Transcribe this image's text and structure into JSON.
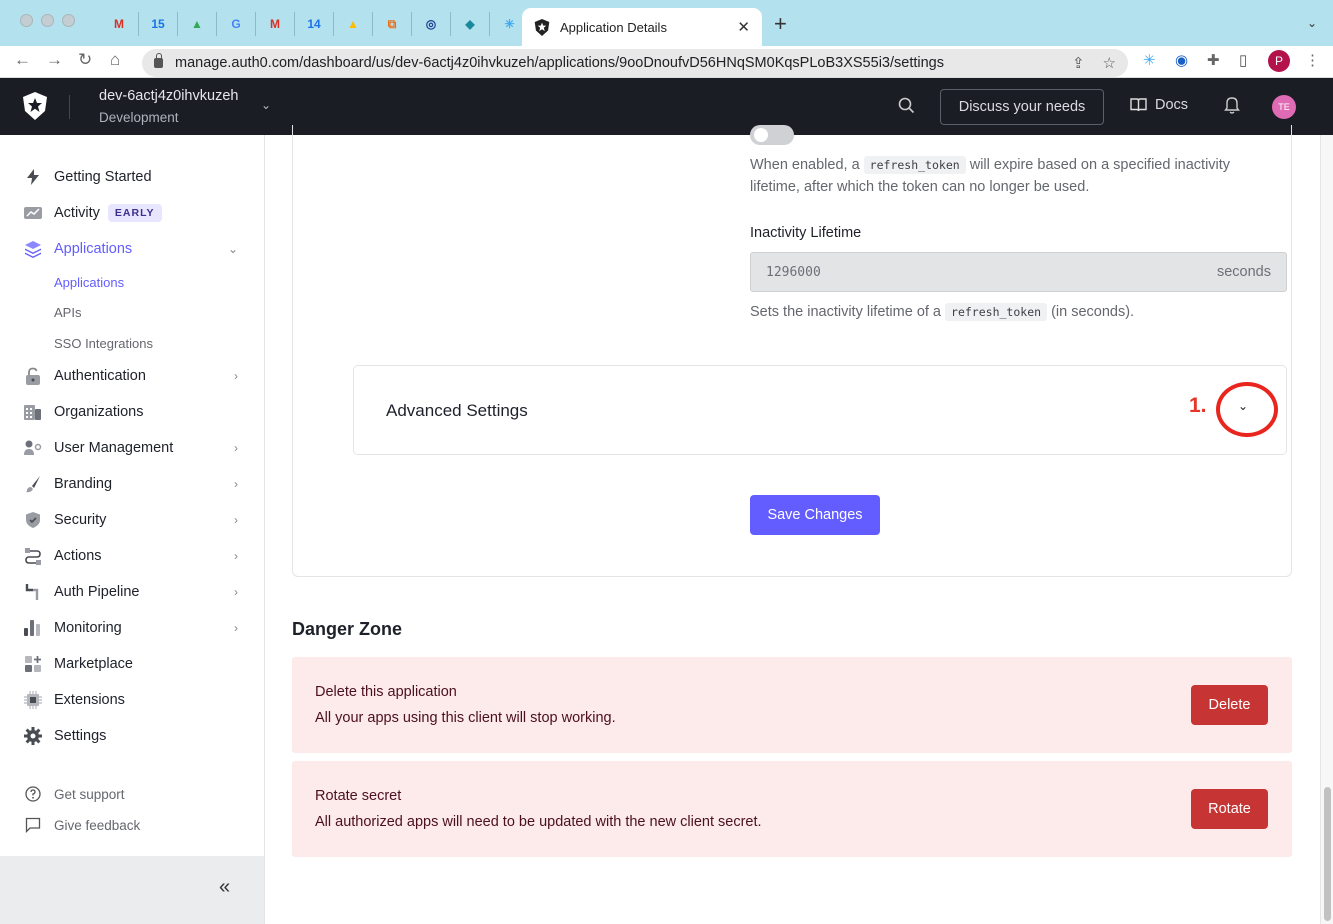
{
  "browser": {
    "pinned_tabs": [
      {
        "icon": "gmail-icon",
        "glyph": "M",
        "color": "#d93025"
      },
      {
        "icon": "calendar-icon",
        "glyph": "15",
        "color": "#1a73e8"
      },
      {
        "icon": "drive-icon",
        "glyph": "▲",
        "color": "#34a853"
      },
      {
        "icon": "google-icon",
        "glyph": "G",
        "color": "#4285f4"
      },
      {
        "icon": "gmail-icon",
        "glyph": "M",
        "color": "#d93025"
      },
      {
        "icon": "calendar-icon",
        "glyph": "14",
        "color": "#1a73e8"
      },
      {
        "icon": "drive-icon",
        "glyph": "▲",
        "color": "#fbbc04"
      },
      {
        "icon": "app-icon",
        "glyph": "⧉",
        "color": "#e8711a"
      },
      {
        "icon": "circle-app-icon",
        "glyph": "◎",
        "color": "#1c3f94"
      },
      {
        "icon": "diamond-icon",
        "glyph": "◆",
        "color": "#1a8a9a"
      },
      {
        "icon": "asterisk-icon",
        "glyph": "✳",
        "color": "#3fa9f5"
      }
    ],
    "active_tab_title": "Application Details",
    "url": "manage.auth0.com/dashboard/us/dev-6actj4z0ihvkuzeh/applications/9ooDnoufvD56HNqSM0KqsPLoB3XS55i3/settings",
    "profile_initial": "P"
  },
  "header": {
    "tenant_name": "dev-6actj4z0ihvkuzeh",
    "tenant_env": "Development",
    "discuss_label": "Discuss your needs",
    "docs_label": "Docs",
    "avatar_initials": "TE"
  },
  "sidebar": {
    "items": [
      {
        "label": "Getting Started",
        "icon": "lightning-icon"
      },
      {
        "label": "Activity",
        "icon": "activity-icon",
        "badge": "EARLY"
      },
      {
        "label": "Applications",
        "icon": "layers-icon"
      },
      {
        "label": "Authentication",
        "icon": "lock-icon"
      },
      {
        "label": "Organizations",
        "icon": "building-icon"
      },
      {
        "label": "User Management",
        "icon": "users-icon"
      },
      {
        "label": "Branding",
        "icon": "brush-icon"
      },
      {
        "label": "Security",
        "icon": "shield-icon"
      },
      {
        "label": "Actions",
        "icon": "actions-icon"
      },
      {
        "label": "Auth Pipeline",
        "icon": "pipeline-icon"
      },
      {
        "label": "Monitoring",
        "icon": "bar-chart-icon"
      },
      {
        "label": "Marketplace",
        "icon": "marketplace-icon"
      },
      {
        "label": "Extensions",
        "icon": "chip-icon"
      },
      {
        "label": "Settings",
        "icon": "gear-icon"
      }
    ],
    "sub_items": [
      "Applications",
      "APIs",
      "SSO Integrations"
    ],
    "footer": [
      {
        "label": "Get support",
        "icon": "help-icon"
      },
      {
        "label": "Give feedback",
        "icon": "feedback-icon"
      }
    ]
  },
  "main": {
    "toggle_enabled": false,
    "help_pre": "When enabled, a ",
    "help_code": "refresh_token",
    "help_post": " will expire based on a specified inactivity lifetime, after which the token can no longer be used.",
    "inactivity_label": "Inactivity Lifetime",
    "inactivity_value": "1296000",
    "inactivity_suffix": "seconds",
    "inactivity_help_pre": "Sets the inactivity lifetime of a ",
    "inactivity_help_code": "refresh_token",
    "inactivity_help_post": " (in seconds).",
    "advanced_title": "Advanced Settings",
    "annotation": "1.",
    "save_label": "Save Changes",
    "danger_title": "Danger Zone",
    "danger": [
      {
        "title": "Delete this application",
        "desc": "All your apps using this client will stop working.",
        "button": "Delete"
      },
      {
        "title": "Rotate secret",
        "desc": "All authorized apps will need to be updated with the new client secret.",
        "button": "Rotate"
      }
    ]
  },
  "colors": {
    "accent": "#635dff",
    "danger": "#c73434",
    "danger_bg": "#fdeaea"
  }
}
